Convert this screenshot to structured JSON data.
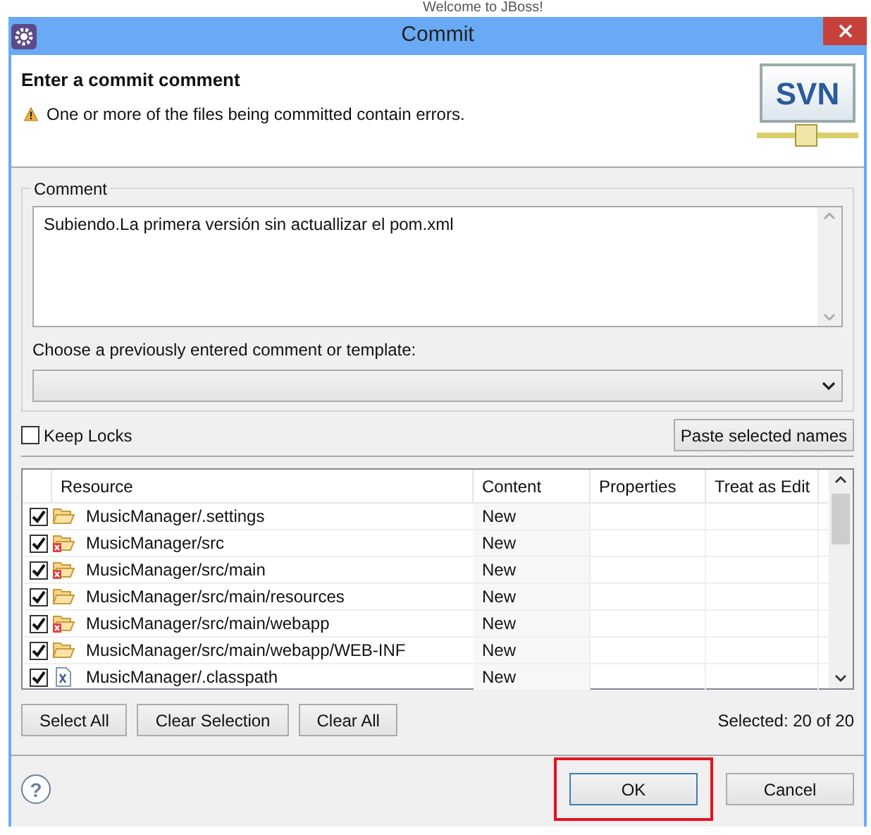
{
  "background": {
    "heading": "Welcome to JBoss!"
  },
  "window": {
    "title": "Commit"
  },
  "header": {
    "title": "Enter a commit comment",
    "message": "One or more of the files being committed contain errors.",
    "logo": "SVN"
  },
  "comment": {
    "group_label": "Comment",
    "value": "Subiendo.La primera versión sin actuallizar el pom.xml",
    "template_label": "Choose a previously entered comment or template:"
  },
  "keep_locks": {
    "label": "Keep Locks",
    "checked": false
  },
  "paste_button": "Paste selected names",
  "table": {
    "columns": [
      "Resource",
      "Content",
      "Properties",
      "Treat as Edit"
    ],
    "rows": [
      {
        "kind": "folder",
        "checked": true,
        "resource": "MusicManager/.settings",
        "content": "New"
      },
      {
        "kind": "error-folder",
        "checked": true,
        "resource": "MusicManager/src",
        "content": "New"
      },
      {
        "kind": "error-folder",
        "checked": true,
        "resource": "MusicManager/src/main",
        "content": "New"
      },
      {
        "kind": "folder",
        "checked": true,
        "resource": "MusicManager/src/main/resources",
        "content": "New"
      },
      {
        "kind": "error-folder",
        "checked": true,
        "resource": "MusicManager/src/main/webapp",
        "content": "New"
      },
      {
        "kind": "folder",
        "checked": true,
        "resource": "MusicManager/src/main/webapp/WEB-INF",
        "content": "New"
      },
      {
        "kind": "xml-file",
        "checked": true,
        "resource": "MusicManager/.classpath",
        "content": "New"
      }
    ]
  },
  "selection_buttons": [
    "Select All",
    "Clear Selection",
    "Clear All"
  ],
  "selected_count": "Selected: 20 of 20",
  "help_button": "?",
  "footer_buttons": [
    {
      "label": "OK",
      "kind": "default"
    },
    {
      "label": "Cancel",
      "kind": "normal"
    }
  ]
}
